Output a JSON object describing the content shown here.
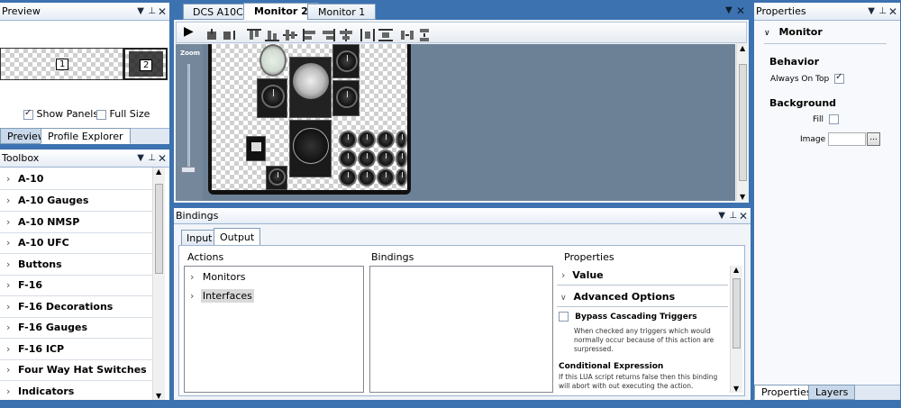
{
  "preview_panel": {
    "title": "Preview",
    "monitor1_num": "1",
    "monitor2_num": "2",
    "show_panels_label": "Show Panels",
    "show_panels_checked": true,
    "full_size_label": "Full Size",
    "full_size_checked": false,
    "tabs": [
      "Preview",
      "Profile Explorer"
    ]
  },
  "toolbox": {
    "title": "Toolbox",
    "items": [
      "A-10",
      "A-10 Gauges",
      "A-10 NMSP",
      "A-10 UFC",
      "Buttons",
      "F-16",
      "F-16 Decorations",
      "F-16 Gauges",
      "F-16 ICP",
      "Four Way Hat Switches",
      "Indicators"
    ]
  },
  "editor": {
    "tabs": [
      "DCS A10C",
      "Monitor 2",
      "Monitor 1"
    ],
    "active_tab": "Monitor 2",
    "zoom_label": "Zoom"
  },
  "bindings": {
    "title": "Bindings",
    "tabs": [
      "Input",
      "Output"
    ],
    "active_tab": "Output",
    "actions_header": "Actions",
    "actions": [
      "Monitors",
      "Interfaces"
    ],
    "bindings_header": "Bindings",
    "properties_header": "Properties",
    "value_label": "Value",
    "advanced_label": "Advanced Options",
    "bypass_label": "Bypass Cascading Triggers",
    "bypass_desc": "When checked any triggers which would normally occur because of this action are surpressed.",
    "conditional_label": "Conditional Expression",
    "conditional_desc": "If this LUA script returns false then this binding will abort with out executing the action."
  },
  "properties_panel": {
    "title": "Properties",
    "section": "Monitor",
    "behavior_header": "Behavior",
    "always_on_top_label": "Always On Top",
    "always_on_top_checked": true,
    "background_header": "Background",
    "fill_label": "Fill",
    "fill_checked": false,
    "image_label": "Image",
    "browse_label": "...",
    "tabs": [
      "Properties",
      "Layers"
    ]
  },
  "colors": {
    "app_background": "#3c72b0",
    "canvas_background": "#6d8196",
    "title_gradient_end": "#e6edf6"
  }
}
